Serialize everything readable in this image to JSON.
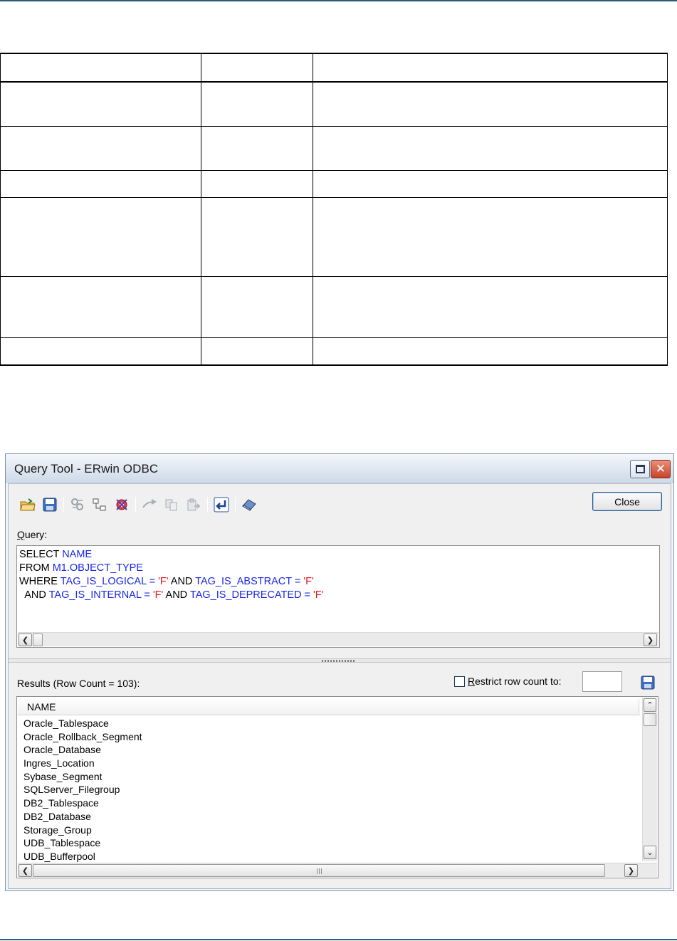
{
  "window": {
    "title": "Query Tool - ERwin ODBC",
    "close_label": "Close"
  },
  "toolbar": {
    "icons": [
      "open-folder-icon",
      "save-icon",
      "link-icon",
      "relationship-icon",
      "object-model-icon",
      "connect-icon",
      "copy-icon",
      "paste-icon",
      "execute-icon",
      "clear-icon"
    ]
  },
  "query": {
    "label_prefix": "",
    "label_accel": "Q",
    "label_rest": "uery:",
    "lines": [
      [
        {
          "t": "SELECT ",
          "c": "kw"
        },
        {
          "t": "NAME",
          "c": "id"
        }
      ],
      [
        {
          "t": "FROM ",
          "c": "kw"
        },
        {
          "t": "M1.OBJECT_TYPE",
          "c": "id"
        }
      ],
      [
        {
          "t": "WHERE ",
          "c": "kw"
        },
        {
          "t": "TAG_IS_LOGICAL = ",
          "c": "id"
        },
        {
          "t": "'F'",
          "c": "str"
        },
        {
          "t": " AND ",
          "c": "kw"
        },
        {
          "t": "TAG_IS_ABSTRACT = ",
          "c": "id"
        },
        {
          "t": "'F'",
          "c": "str"
        }
      ],
      [
        {
          "t": "  AND ",
          "c": "kw"
        },
        {
          "t": "TAG_IS_INTERNAL = ",
          "c": "id"
        },
        {
          "t": "'F'",
          "c": "str"
        },
        {
          "t": " AND ",
          "c": "kw"
        },
        {
          "t": "TAG_IS_DEPRECATED = ",
          "c": "id"
        },
        {
          "t": "'F'",
          "c": "str"
        }
      ]
    ]
  },
  "results": {
    "label": "Results (Row Count = 103):",
    "restrict_accel": "R",
    "restrict_rest": "estrict row count to:",
    "restrict_checked": false,
    "row_limit_value": "",
    "column": "NAME",
    "rows": [
      "Oracle_Tablespace",
      "Oracle_Rollback_Segment",
      "Oracle_Database",
      "Ingres_Location",
      "Sybase_Segment",
      "SQLServer_Filegroup",
      "DB2_Tablespace",
      "DB2_Database",
      "Storage_Group",
      "UDB_Tablespace",
      "UDB_Bufferpool"
    ]
  },
  "colors": {
    "keyword": "#000000",
    "identifier": "#1a27e6",
    "string": "#e4141e"
  }
}
